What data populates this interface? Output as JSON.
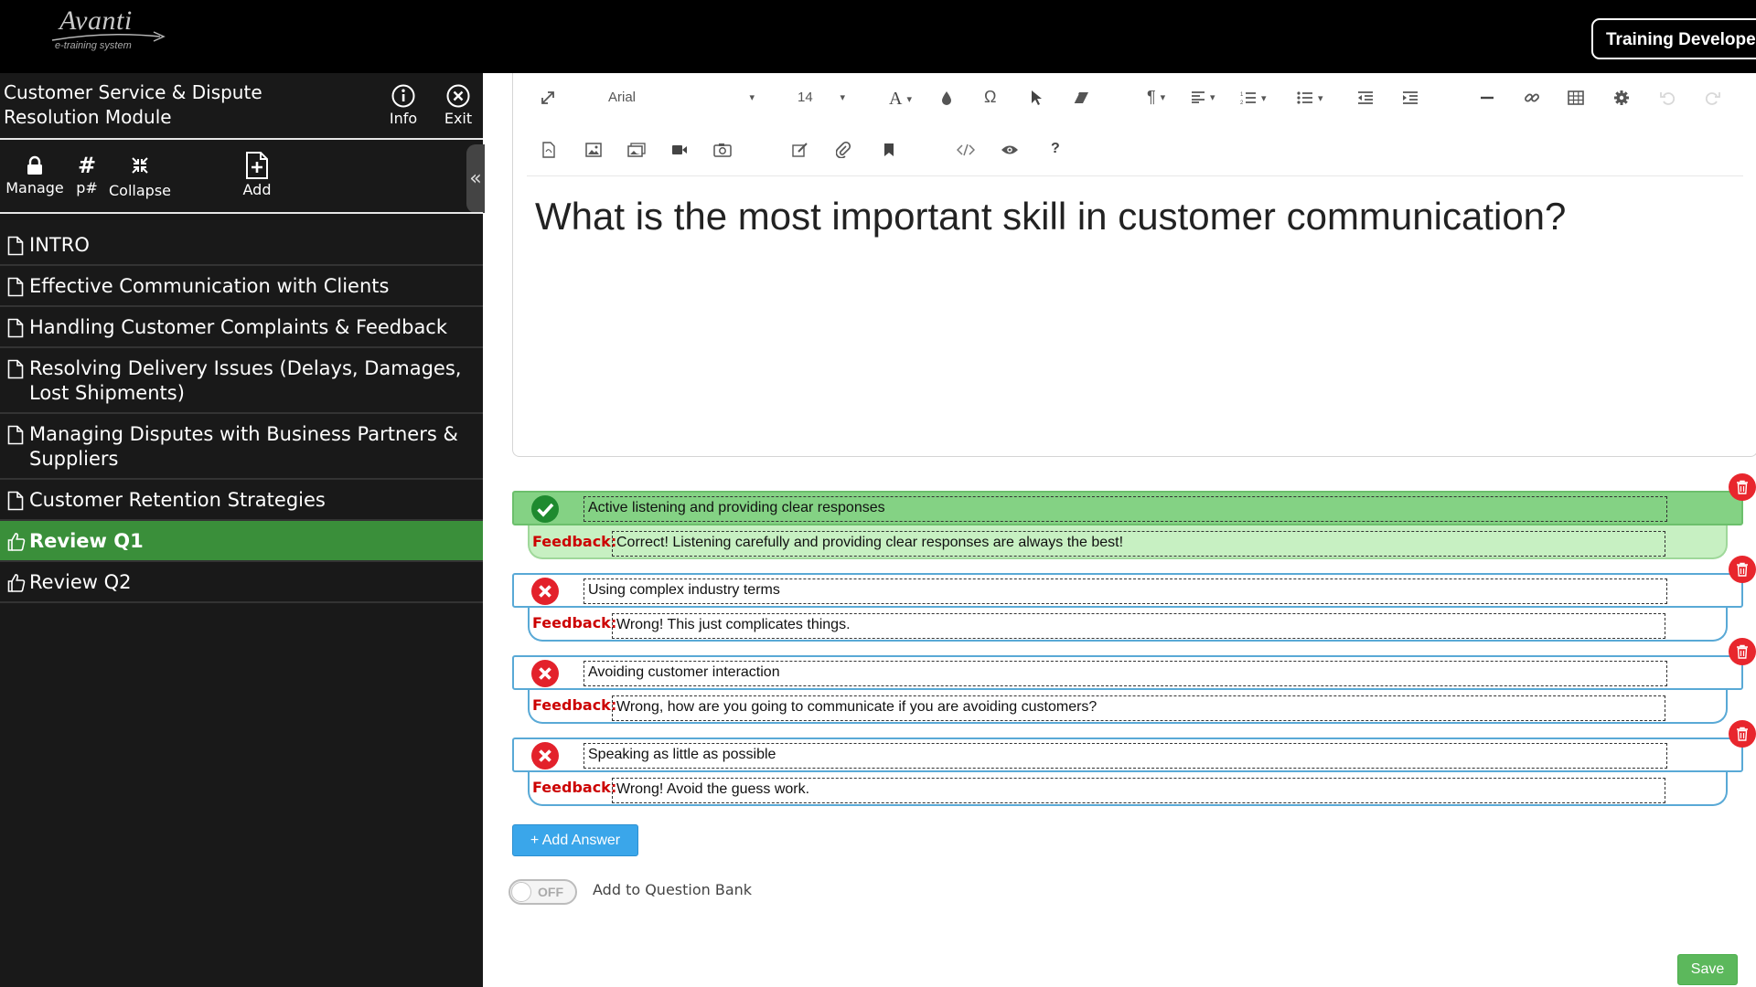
{
  "app": {
    "logo_text": "Avanti",
    "logo_subtext": "e-training system",
    "role_button": "Training Develope"
  },
  "sidebar": {
    "module_title": "Customer Service & Dispute Resolution Module",
    "info_label": "Info",
    "exit_label": "Exit",
    "tools": {
      "manage": "Manage",
      "page_numbers": "p#",
      "collapse": "Collapse",
      "add": "Add"
    },
    "items": [
      {
        "label": "INTRO",
        "icon": "page-icon",
        "active": false
      },
      {
        "label": "Effective Communication with Clients",
        "icon": "page-icon",
        "active": false
      },
      {
        "label": "Handling Customer Complaints & Feedback",
        "icon": "page-icon",
        "active": false
      },
      {
        "label": "Resolving Delivery Issues (Delays, Damages, Lost Shipments)",
        "icon": "page-icon",
        "active": false
      },
      {
        "label": "Managing Disputes with Business Partners & Suppliers",
        "icon": "page-icon",
        "active": false
      },
      {
        "label": "Customer Retention Strategies",
        "icon": "page-icon",
        "active": false
      },
      {
        "label": "Review Q1",
        "icon": "thumbs-up-icon",
        "active": true
      },
      {
        "label": "Review Q2",
        "icon": "thumbs-up-icon",
        "active": false
      }
    ]
  },
  "editor": {
    "font_family": "Arial",
    "font_size": "14",
    "help_glyph": "?",
    "question_text": "What is the most important skill in customer communication?"
  },
  "answers": [
    {
      "text": "Active listening and providing clear responses",
      "feedback_label": "Feedback:",
      "feedback": "Correct! Listening carefully and providing clear responses are always the best!",
      "correct": true
    },
    {
      "text": "Using complex industry terms",
      "feedback_label": "Feedback:",
      "feedback": "Wrong! This just complicates things.",
      "correct": false
    },
    {
      "text": "Avoiding customer interaction",
      "feedback_label": "Feedback:",
      "feedback": "Wrong, how are you going to communicate if you are avoiding customers?",
      "correct": false
    },
    {
      "text": "Speaking as little as possible",
      "feedback_label": "Feedback:",
      "feedback": "Wrong! Avoid the guess work.",
      "correct": false
    }
  ],
  "footer": {
    "add_answer": "+ Add Answer",
    "toggle_state": "OFF",
    "question_bank_label": "Add to Question Bank",
    "save": "Save"
  },
  "colors": {
    "topbar": "#000000",
    "sidebar": "#191919",
    "active_item": "#3a8f3a",
    "correct_answer": "#84d284",
    "correct_feedback": "#c7f0c2",
    "answer_border": "#59a9d6",
    "feedback_label": "#cc0000",
    "delete_button": "#e8262d",
    "add_answer_button": "#3aa6ea",
    "save_button": "#5cb85c"
  }
}
